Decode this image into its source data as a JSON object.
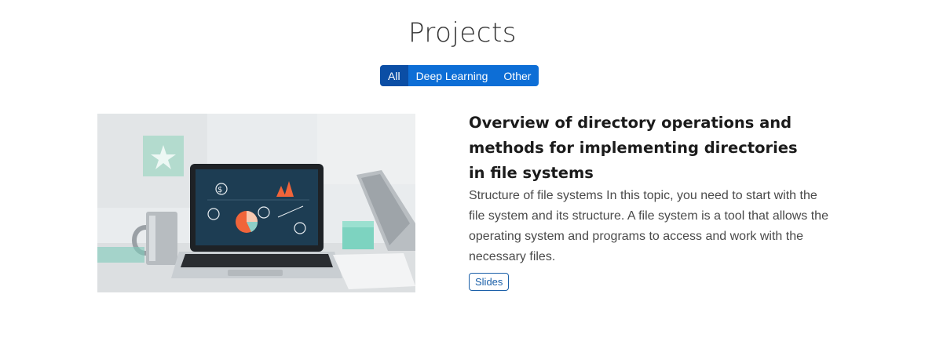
{
  "header": {
    "title": "Projects"
  },
  "filters": [
    {
      "label": "All",
      "active": true
    },
    {
      "label": "Deep Learning",
      "active": false
    },
    {
      "label": "Other",
      "active": false
    }
  ],
  "project": {
    "image_icon": "laptop-dashboard-photo",
    "title": "Overview of directory operations and methods for implementing directories in file systems",
    "description": "Structure of file systems In this topic, you need to start with the file system and its structure. A file system is a tool that allows the operating system and programs to access and work with the necessary files.",
    "link_label": "Slides"
  },
  "colors": {
    "filter_active": "#0b4ea5",
    "filter_default": "#0d6ed6",
    "link": "#1a5fa8"
  }
}
